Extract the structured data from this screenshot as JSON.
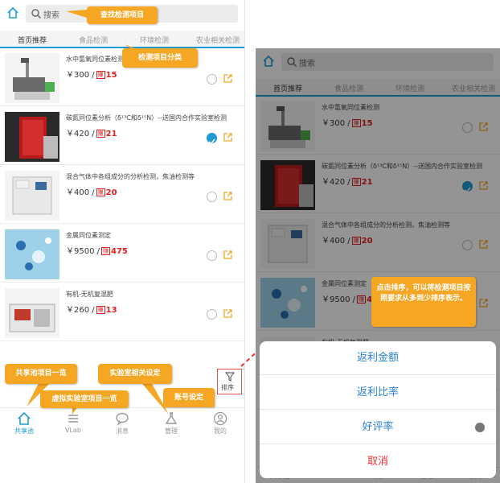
{
  "colors": {
    "accent": "#1f9bd3",
    "callout": "#f5a623",
    "red": "#e21e1e"
  },
  "search": {
    "placeholder": "搜索"
  },
  "tabs": [
    "首页推荐",
    "食品检测",
    "环境检测",
    "农业相关检测"
  ],
  "items": [
    {
      "title": "水中氢氧同位素检测",
      "price": "￥300 /",
      "tag": "赚",
      "rebate": "15",
      "checked": false
    },
    {
      "title": "碳氮同位素分析（δ¹³C和δ¹⁵N）--送国内合作实验室检测",
      "price": "￥420 /",
      "tag": "赚",
      "rebate": "21",
      "checked": true
    },
    {
      "title": "混合气体中各组成分的分析检测，焦油检测等",
      "price": "￥400 /",
      "tag": "赚",
      "rebate": "20",
      "checked": false
    },
    {
      "title": "金属同位素测定",
      "price": "￥9500 /",
      "tag": "赚",
      "rebate": "475",
      "checked": false
    },
    {
      "title": "有机-无机复混肥",
      "price": "￥260 /",
      "tag": "赚",
      "rebate": "13",
      "checked": false
    }
  ],
  "sort_label": "排序",
  "nav": [
    {
      "label": "共享池",
      "icon": "pool-icon"
    },
    {
      "label": "VLab",
      "icon": "list-icon"
    },
    {
      "label": "消息",
      "icon": "message-icon"
    },
    {
      "label": "管理",
      "icon": "flask-icon"
    },
    {
      "label": "我的",
      "icon": "user-icon"
    }
  ],
  "callouts": {
    "search": "查找检测项目",
    "category": "检测项目分类",
    "shared": "共享池项目一览",
    "lab": "实验室相关设定",
    "vlab": "虚拟实验室项目一览",
    "account": "账号设定",
    "sort": "点击排序，可以将检测项目按照要求从多到少排序表示。"
  },
  "sheet": {
    "options": [
      "返利金额",
      "返利比率",
      "好评率"
    ],
    "cancel": "取消"
  }
}
